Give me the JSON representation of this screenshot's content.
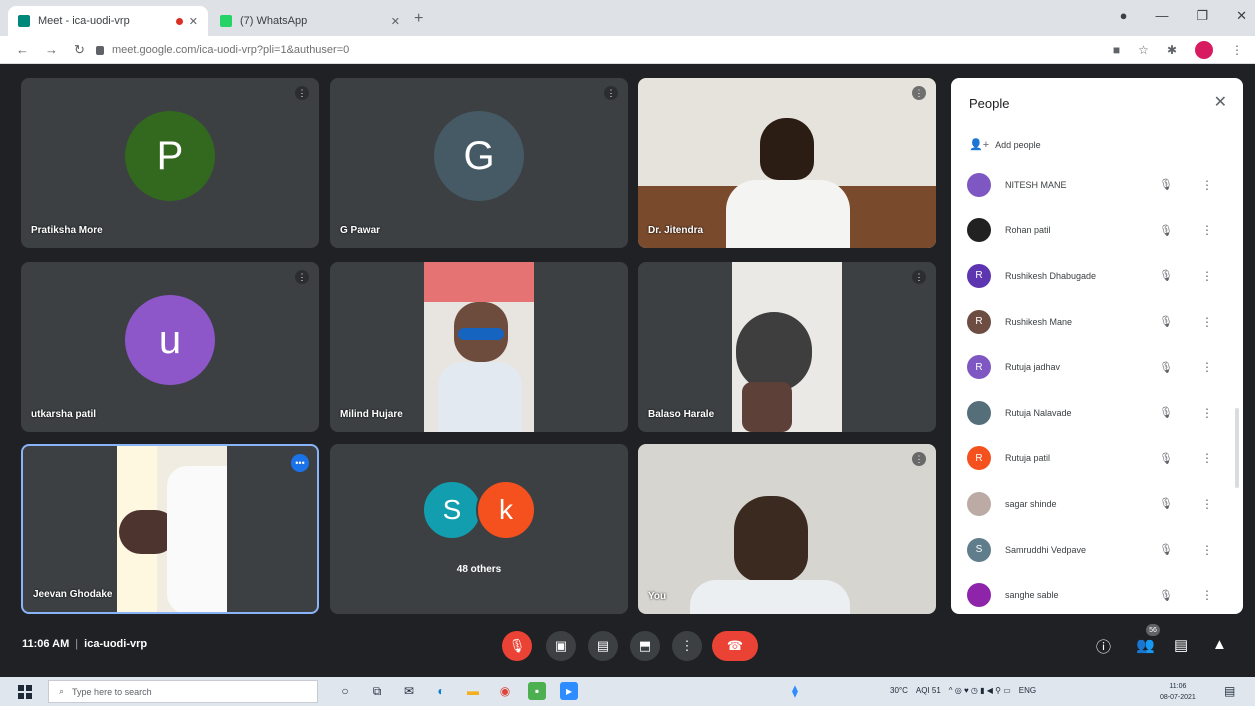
{
  "browser": {
    "tabs": [
      {
        "title": "Meet - ica-uodi-vrp",
        "active": true
      },
      {
        "title": "(7) WhatsApp",
        "active": false
      }
    ],
    "url": "meet.google.com/ica-uodi-vrp?pli=1&authuser=0"
  },
  "tiles": [
    {
      "name": "Pratiksha More",
      "initial": "P",
      "color": "#33691e",
      "kind": "avatar"
    },
    {
      "name": "G Pawar",
      "initial": "G",
      "color": "#455a64",
      "kind": "avatar"
    },
    {
      "name": "Dr. Jitendra",
      "kind": "video"
    },
    {
      "name": "utkarsha patil",
      "initial": "u",
      "color": "#8e57c9",
      "kind": "avatar"
    },
    {
      "name": "Milind Hujare",
      "kind": "video"
    },
    {
      "name": "Balaso Harale",
      "kind": "video"
    },
    {
      "name": "Jeevan Ghodake",
      "kind": "video"
    },
    {
      "kind": "others",
      "label": "48 others",
      "avatars": [
        {
          "initial": "S",
          "color": "#129eaf"
        },
        {
          "initial": "k",
          "color": "#f4511e"
        }
      ]
    },
    {
      "name": "You",
      "kind": "video"
    }
  ],
  "panel": {
    "title": "People",
    "add_people": "Add people",
    "participants": [
      {
        "name": "NITESH MANE",
        "color": "#7e57c2",
        "initial": ""
      },
      {
        "name": "Rohan patil",
        "color": "#212121",
        "initial": ""
      },
      {
        "name": "Rushikesh Dhabugade",
        "color": "#5e35b1",
        "initial": "R"
      },
      {
        "name": "Rushikesh Mane",
        "color": "#6d4c41",
        "initial": "R"
      },
      {
        "name": "Rutuja jadhav",
        "color": "#7e57c2",
        "initial": "R"
      },
      {
        "name": "Rutuja Nalavade",
        "color": "#546e7a",
        "initial": ""
      },
      {
        "name": "Rutuja patil",
        "color": "#f4511e",
        "initial": "R"
      },
      {
        "name": "sagar shinde",
        "color": "#bcaaa4",
        "initial": ""
      },
      {
        "name": "Samruddhi Vedpave",
        "color": "#607d8b",
        "initial": "S"
      },
      {
        "name": "sanghe sable",
        "color": "#8e24aa",
        "initial": ""
      }
    ]
  },
  "meeting": {
    "time": "11:06 AM",
    "code": "ica-uodi-vrp",
    "people_count": "56"
  },
  "taskbar": {
    "search_placeholder": "Type here to search",
    "tray": [
      "30°C",
      "AQI 51",
      "ENG"
    ],
    "time": "11:06",
    "date": "08-07-2021"
  }
}
